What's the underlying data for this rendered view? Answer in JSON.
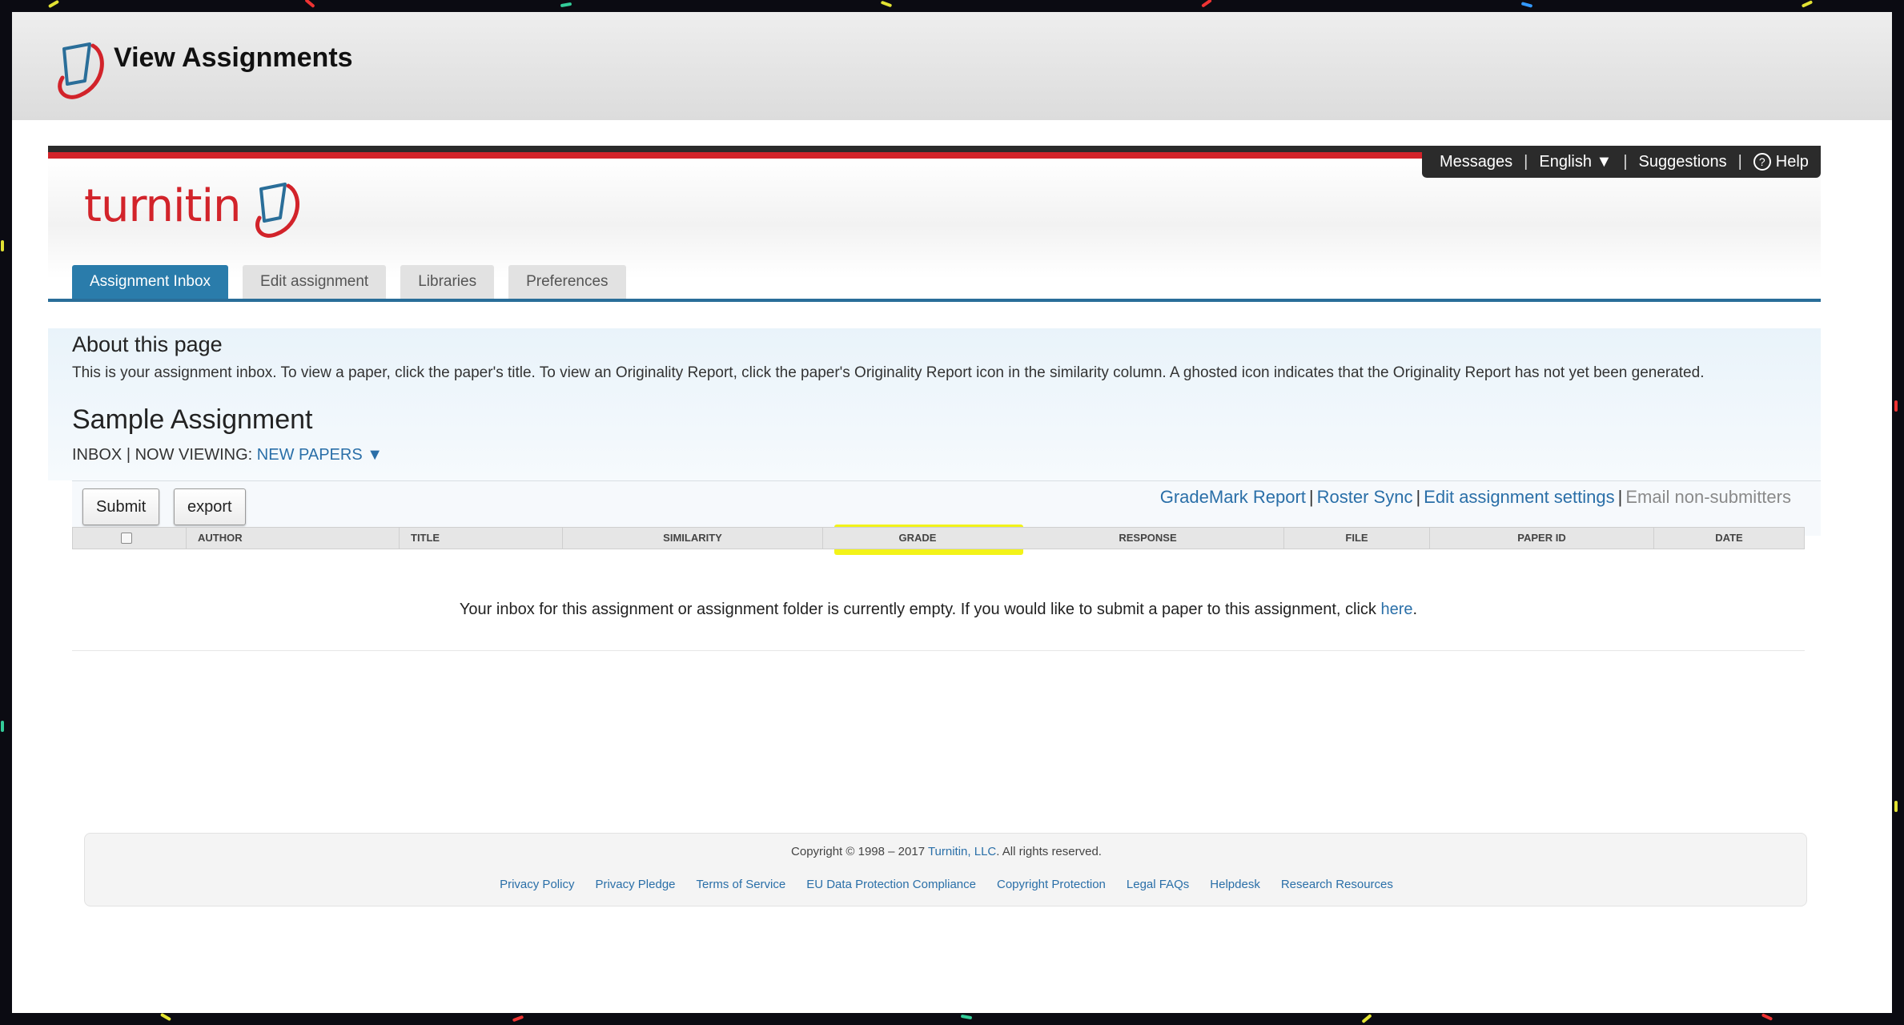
{
  "window": {
    "title": "View Assignments"
  },
  "top_nav": {
    "messages": "Messages",
    "language": "English ▼",
    "suggestions": "Suggestions",
    "help": "Help",
    "separator": "|"
  },
  "brand": {
    "name": "turnitin",
    "accent_color": "#d2232a"
  },
  "tabs": [
    {
      "label": "Assignment Inbox",
      "active": true
    },
    {
      "label": "Edit assignment",
      "active": false
    },
    {
      "label": "Libraries",
      "active": false
    },
    {
      "label": "Preferences",
      "active": false
    }
  ],
  "about": {
    "title": "About this page",
    "text": "This is your assignment inbox. To view a paper, click the paper's title. To view an Originality Report, click the paper's Originality Report icon in the similarity column. A ghosted icon indicates that the Originality Report has not yet been generated."
  },
  "assignment": {
    "title": "Sample Assignment",
    "inbox_label": "INBOX",
    "viewing_label": "| NOW VIEWING:",
    "viewing_value": "NEW PAPERS ▼"
  },
  "toolbar": {
    "submit": "Submit",
    "export": "export",
    "grademark_report": "GradeMark Report",
    "roster_sync": "Roster Sync",
    "edit_settings": "Edit assignment settings",
    "email_non_submitters": "Email non-submitters",
    "pipe": "|"
  },
  "table": {
    "columns": [
      "AUTHOR",
      "TITLE",
      "SIMILARITY",
      "GRADE",
      "RESPONSE",
      "FILE",
      "PAPER ID",
      "DATE"
    ],
    "highlighted_column": "GRADE",
    "highlight_color": "#f2f200"
  },
  "empty": {
    "message": "Your inbox for this assignment or assignment folder is currently empty. If you would like to submit a paper to this assignment, click",
    "link": "here",
    "suffix": "."
  },
  "footer": {
    "copyright_prefix": "Copyright © 1998 – 2017",
    "company": "Turnitin, LLC",
    "copyright_suffix": ". All rights reserved.",
    "links": [
      "Privacy Policy",
      "Privacy Pledge",
      "Terms of Service",
      "EU Data Protection Compliance",
      "Copyright Protection",
      "Legal FAQs",
      "Helpdesk",
      "Research Resources"
    ]
  }
}
